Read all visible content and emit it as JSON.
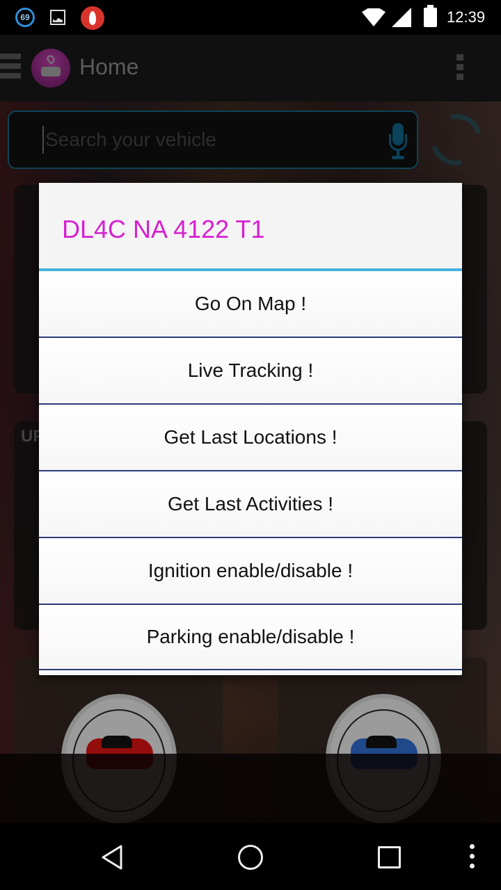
{
  "status_bar": {
    "notification_badge": "69",
    "time": "12:39",
    "icons": [
      "progress-badge-icon",
      "gallery-icon",
      "flame-app-icon",
      "wifi-icon",
      "cell-signal-icon",
      "battery-icon"
    ]
  },
  "app_bar": {
    "title": "Home",
    "icons": [
      "hamburger-menu-icon",
      "app-logo-car-pin-icon",
      "overflow-menu-icon"
    ]
  },
  "search": {
    "placeholder": "Search your vehicle",
    "value": "",
    "icons": [
      "microphone-icon",
      "refresh-icon"
    ]
  },
  "background": {
    "card_label_partial": "UP"
  },
  "dialog": {
    "title": "DL4C NA 4122 T1",
    "title_color": "#d620d0",
    "accent_color": "#45b1dc",
    "items": [
      {
        "label": "Go On Map !"
      },
      {
        "label": "Live Tracking !"
      },
      {
        "label": "Get Last Locations !"
      },
      {
        "label": "Get Last Activities !"
      },
      {
        "label": "Ignition enable/disable !"
      },
      {
        "label": "Parking enable/disable !"
      }
    ]
  },
  "nav_bar": {
    "icons": [
      "back-icon",
      "home-icon",
      "recents-icon",
      "menu-icon"
    ]
  }
}
